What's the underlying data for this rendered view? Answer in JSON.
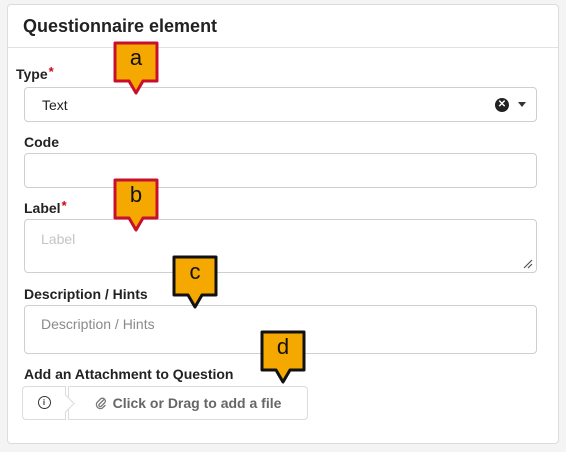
{
  "panel": {
    "title": "Questionnaire element"
  },
  "fields": {
    "type": {
      "label": "Type",
      "required_mark": "*",
      "value": "Text",
      "clear_icon": "clear-circle-icon",
      "dropdown_icon": "caret-down-icon"
    },
    "code": {
      "label": "Code",
      "value": ""
    },
    "label": {
      "label": "Label",
      "required_mark": "*",
      "placeholder": "Label",
      "value": ""
    },
    "description": {
      "label": "Description / Hints",
      "placeholder": "Description / Hints",
      "value": ""
    },
    "attachment": {
      "label": "Add an Attachment to Question",
      "info_icon": "info-icon",
      "upload_icon": "paperclip-icon",
      "upload_label": "Click or Drag to add a file"
    }
  },
  "callouts": {
    "a": "a",
    "b": "b",
    "c": "c",
    "d": "d"
  },
  "colors": {
    "callout_fill": "#f5a800",
    "callout_border_red": "#c8102e",
    "callout_border_dark": "#111111",
    "required": "#d0021b"
  }
}
